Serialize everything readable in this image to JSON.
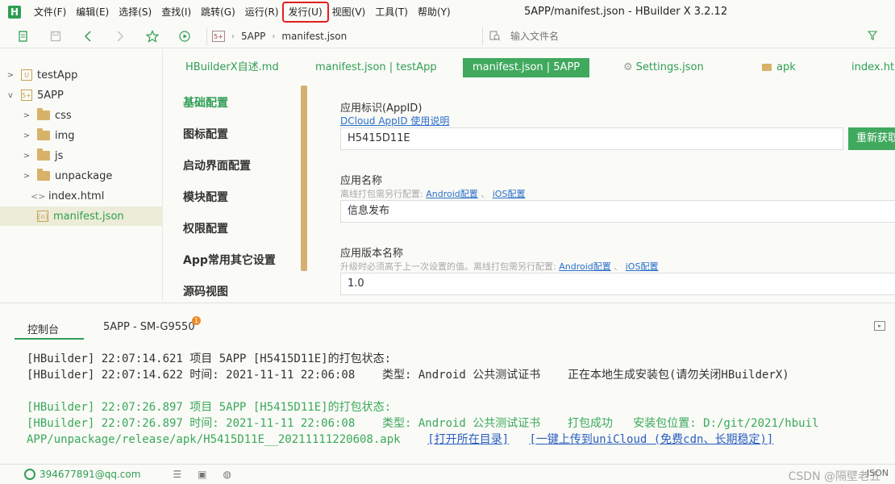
{
  "app": {
    "logo": "H",
    "window_title": "5APP/manifest.json - HBuilder X 3.2.12",
    "menu": [
      "文件(F)",
      "编辑(E)",
      "选择(S)",
      "查找(I)",
      "跳转(G)",
      "运行(R)",
      "发行(U)",
      "视图(V)",
      "工具(T)",
      "帮助(Y)"
    ],
    "highlighted_menu_index": 6,
    "accent_color": "#2f9e53",
    "highlight_color": "#e02020"
  },
  "toolbar": {
    "crumb_icon": "5+",
    "crumb_project": "5APP",
    "crumb_file": "manifest.json",
    "file_search_placeholder": "输入文件名",
    "icons": [
      "new-file-icon",
      "save-icon",
      "back-icon",
      "forward-icon",
      "star-icon",
      "run-icon",
      "filter-icon"
    ]
  },
  "tree": {
    "items": [
      {
        "label": "testApp",
        "caret": ">",
        "kind": "project",
        "icon": "U"
      },
      {
        "label": "5APP",
        "caret": "v",
        "kind": "project",
        "icon": "5+"
      },
      {
        "label": "css",
        "caret": ">",
        "kind": "folder"
      },
      {
        "label": "img",
        "caret": ">",
        "kind": "folder"
      },
      {
        "label": "js",
        "caret": ">",
        "kind": "folder"
      },
      {
        "label": "unpackage",
        "caret": ">",
        "kind": "folder"
      },
      {
        "label": "index.html",
        "caret": "",
        "kind": "html",
        "icon": "<>"
      },
      {
        "label": "manifest.json",
        "caret": "",
        "kind": "json",
        "icon": "{o}",
        "selected": true
      }
    ]
  },
  "tabs": [
    {
      "label": "HBuilderX自述.md"
    },
    {
      "label": "manifest.json | testApp"
    },
    {
      "label": "manifest.json | 5APP",
      "active": true
    },
    {
      "label": "Settings.json",
      "icon": "⚙"
    },
    {
      "label": "apk",
      "icon": "folder"
    },
    {
      "label": "index.htm"
    }
  ],
  "settings_nav": [
    {
      "label": "基础配置",
      "active": true
    },
    {
      "label": "图标配置"
    },
    {
      "label": "启动界面配置"
    },
    {
      "label": "模块配置"
    },
    {
      "label": "权限配置"
    },
    {
      "label": "App常用其它设置"
    },
    {
      "label": "源码视图"
    }
  ],
  "form": {
    "appid_label": "应用标识(AppID)",
    "appid_help_link": "DCloud AppID 使用说明",
    "appid_value": "H5415D11E",
    "regen_button": "重新获取",
    "name_label": "应用名称",
    "name_help": "离线打包需另行配置:",
    "name_android_link": "Android配置",
    "sep": "、",
    "name_ios_link": "iOS配置",
    "name_value": "信息发布",
    "version_label": "应用版本名称",
    "version_help": "升级时必须高于上一次设置的值。离线打包需另行配置:",
    "version_android_link": "Android配置",
    "version_ios_link": "iOS配置",
    "version_value": "1.0"
  },
  "console": {
    "tab_active": "控制台",
    "tab_device": "5APP - SM-G9550",
    "badge": "1",
    "log1": "[HBuilder] 22:07:14.621 项目 5APP [H5415D11E]的打包状态:",
    "log2": "[HBuilder] 22:07:14.622 时间: 2021-11-11 22:06:08    类型: Android 公共测试证书    正在本地生成安装包(请勿关闭HBuilderX)",
    "log3": "[HBuilder] 22:07:26.897 项目 5APP [H5415D11E]的打包状态:",
    "log4": "[HBuilder] 22:07:26.897 时间: 2021-11-11 22:06:08    类型: Android 公共测试证书    打包成功   安装包位置: D:/git/2021/hbuil",
    "log5_path": "APP/unpackage/release/apk/H5415D11E__20211111220608.apk    ",
    "log5_open": "[打开所在目录]",
    "log5_gap": "   ",
    "log5_upload": "[一键上传到uniCloud (免费cdn、长期稳定)]"
  },
  "status": {
    "user_email": "394677891@qq.com",
    "watermark": "CSDN @隔壁老五",
    "right_text": "JSON"
  }
}
